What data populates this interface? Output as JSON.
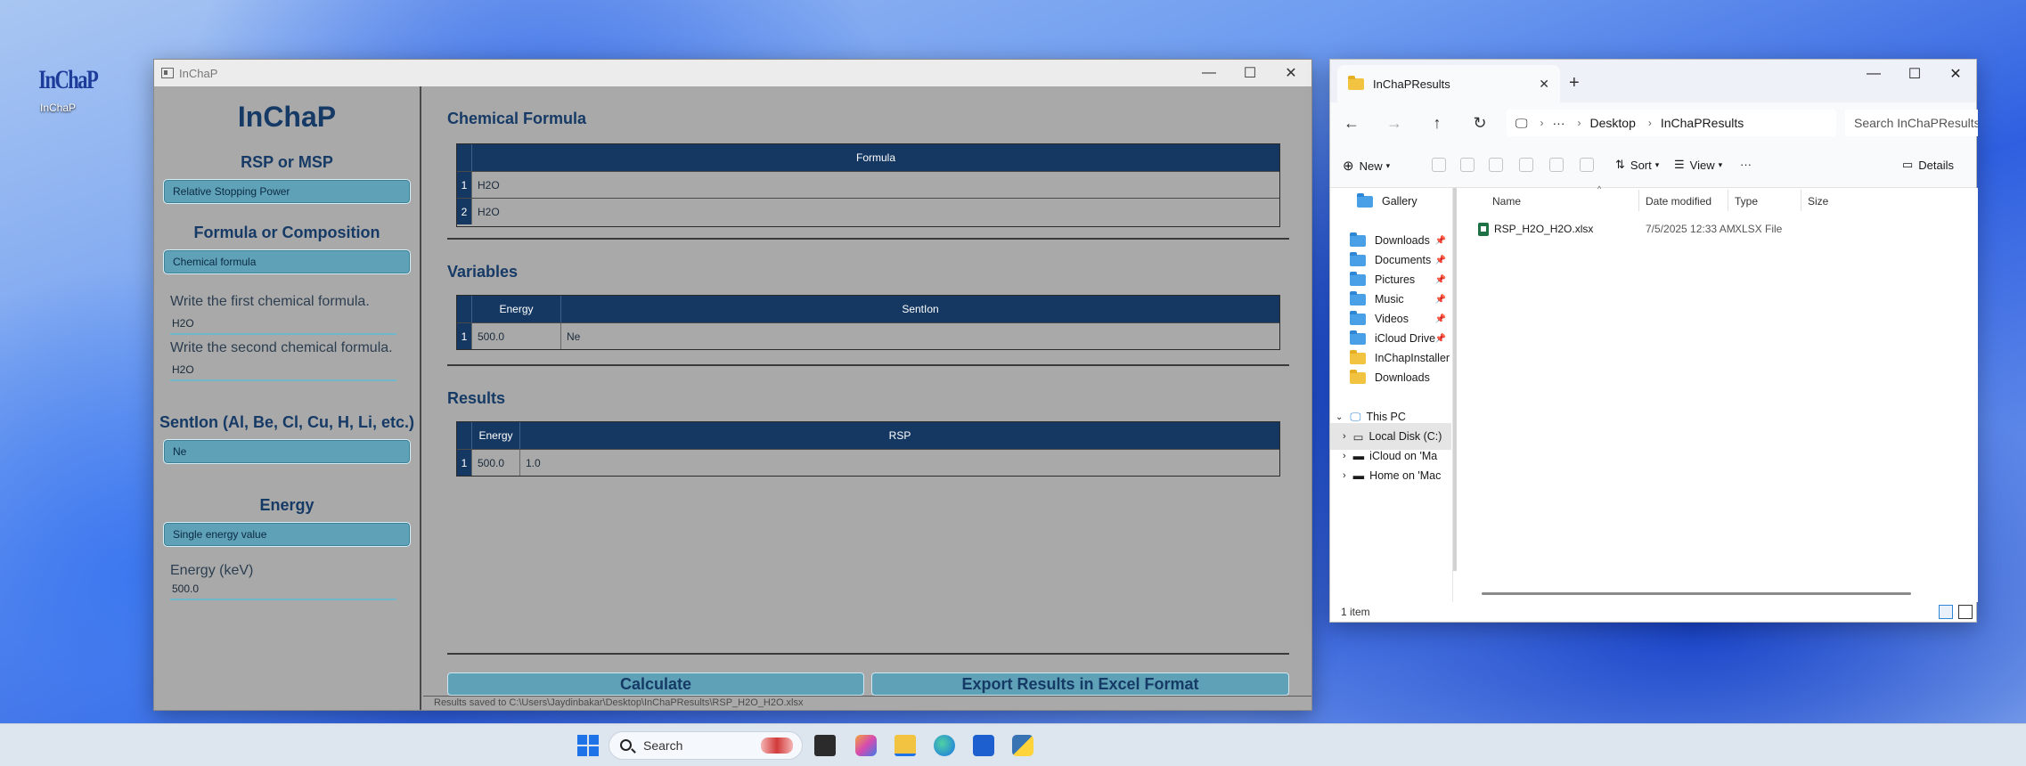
{
  "desktop": {
    "icon_label": "InChaP",
    "icon_logo_text": "InChaP"
  },
  "app": {
    "window_title": "InChaP",
    "brand": "InChaP",
    "sidebar": {
      "rsp_msp_title": "RSP or MSP",
      "rsp_msp_value": "Relative Stopping Power",
      "formula_title": "Formula or Composition",
      "formula_mode_value": "Chemical formula",
      "first_formula_label": "Write the first chemical formula.",
      "first_formula_value": "H2O",
      "second_formula_label": "Write the second chemical formula.",
      "second_formula_value": "H2O",
      "sention_title": "SentIon (Al, Be, Cl, Cu, H, Li, etc.)",
      "sention_value": "Ne",
      "energy_title": "Energy",
      "energy_mode_value": "Single energy value",
      "energy_label": "Energy (keV)",
      "energy_value": "500.0"
    },
    "chemical_formula": {
      "title": "Chemical Formula",
      "column": "Formula",
      "rows": [
        {
          "index": "1",
          "formula": "H2O"
        },
        {
          "index": "2",
          "formula": "H2O"
        }
      ]
    },
    "variables": {
      "title": "Variables",
      "columns": [
        "Energy",
        "SentIon"
      ],
      "rows": [
        {
          "index": "1",
          "energy": "500.0",
          "sention": "Ne"
        }
      ]
    },
    "results": {
      "title": "Results",
      "columns": [
        "Energy",
        "RSP"
      ],
      "rows": [
        {
          "index": "1",
          "energy": "500.0",
          "rsp": "1.0"
        }
      ]
    },
    "buttons": {
      "calculate": "Calculate",
      "export": "Export Results in Excel Format"
    },
    "status": "Results saved to C:\\Users\\Jaydinbakar\\Desktop\\InChaPResults\\RSP_H2O_H2O.xlsx"
  },
  "explorer": {
    "tab_title": "InChaPResults",
    "breadcrumb": [
      "Desktop",
      "InChaPResults"
    ],
    "search_placeholder": "Search InChaPResults",
    "toolbar": {
      "new": "New",
      "sort": "Sort",
      "view": "View",
      "details": "Details"
    },
    "nav": {
      "gallery": "Gallery",
      "downloads": "Downloads",
      "documents": "Documents",
      "pictures": "Pictures",
      "music": "Music",
      "videos": "Videos",
      "icloud_drive": "iCloud Drive",
      "inchapinstaller": "InChapInstaller",
      "downloads2": "Downloads",
      "this_pc": "This PC",
      "local_disk": "Local Disk (C:)",
      "icloud_on": "iCloud on 'Ma",
      "home_on": "Home on 'Mac"
    },
    "columns": {
      "name": "Name",
      "date": "Date modified",
      "type": "Type",
      "size": "Size"
    },
    "file": {
      "name": "RSP_H2O_H2O.xlsx",
      "date": "7/5/2025 12:33 AM",
      "type": "XLSX File"
    },
    "status": "1 item"
  },
  "taskbar": {
    "search_label": "Search"
  },
  "colors": {
    "accent": "#153863",
    "combo": "#5fa1b6",
    "title_text": "#163a66"
  }
}
